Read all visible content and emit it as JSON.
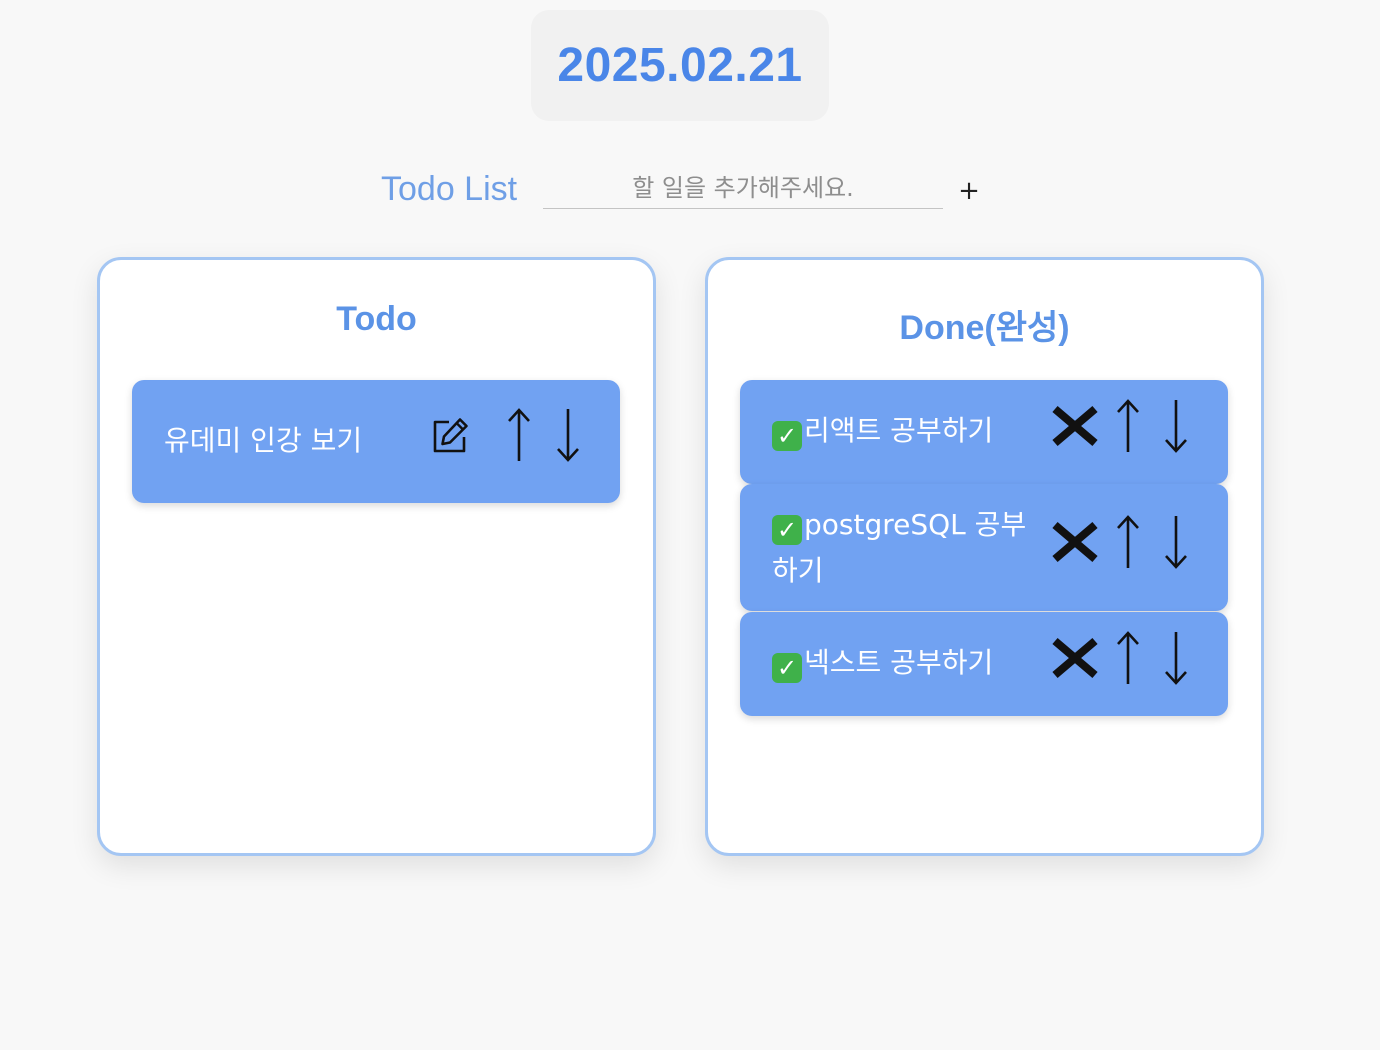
{
  "header": {
    "date": "2025.02.21"
  },
  "input_bar": {
    "label": "Todo List",
    "placeholder": "할 일을 추가해주세요.",
    "value": "",
    "add_label": "+"
  },
  "todo_panel": {
    "title": "Todo",
    "items": [
      {
        "text": "유데미 인강 보기"
      }
    ]
  },
  "done_panel": {
    "title": "Done(완성)",
    "items": [
      {
        "text": "리액트 공부하기"
      },
      {
        "text_line1": "postgreSQL 공부",
        "text_line2": "하기"
      },
      {
        "text": "넥스트 공부하기"
      }
    ]
  },
  "icons": {
    "check": "check-mark-icon",
    "edit": "edit-icon",
    "delete": "x-icon",
    "up": "arrow-up-icon",
    "down": "arrow-down-icon"
  },
  "colors": {
    "accent": "#4a86e8",
    "item_bg": "#71a2f2",
    "panel_border": "#a4c6f3",
    "check_green": "#3fb14a"
  }
}
